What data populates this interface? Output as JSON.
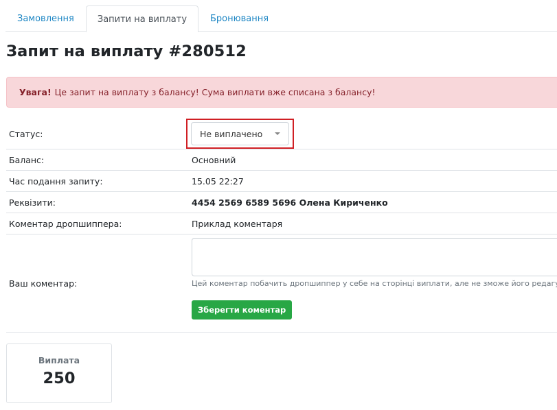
{
  "tabs": [
    {
      "label": "Замовлення"
    },
    {
      "label": "Запити на виплату"
    },
    {
      "label": "Бронювання"
    }
  ],
  "page": {
    "title": "Запит на виплату #280512"
  },
  "alert": {
    "strong": "Увага!",
    "text": "Це запит на виплату з балансу! Сума виплати вже списана з балансу!"
  },
  "details": {
    "status_label": "Статус:",
    "status_value": "Не виплачено",
    "balance_label": "Баланс:",
    "balance_value": "Основний",
    "time_label": "Час подання запиту:",
    "time_value": "15.05 22:27",
    "requisites_label": "Реквізити:",
    "requisites_value": "4454 2569 6589 5696 Олена Кириченко",
    "dropshipper_comment_label": "Коментар дропшиппера:",
    "dropshipper_comment_value": "Приклад коментаря",
    "your_comment_label": "Ваш коментар:",
    "your_comment_value": "",
    "help_text": "Цей коментар побачить дропшиппер у себе на сторінці виплати, але не зможе його редагувати",
    "save_label": "Зберегти коментар"
  },
  "payout": {
    "label": "Виплата",
    "value": "250"
  },
  "colors": {
    "tab_link": "#1f87c4",
    "alert_bg": "#f8d7da",
    "alert_text": "#842029",
    "highlight_border": "#d01f24",
    "save_button": "#28a745"
  },
  "icons": {
    "status_dropdown": "caret-down-icon"
  }
}
